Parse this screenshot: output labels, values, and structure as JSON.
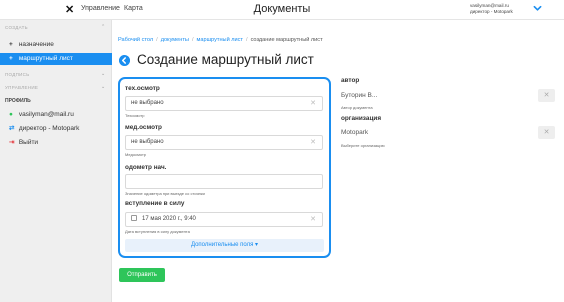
{
  "topbar": {
    "close_icon": "close-icon",
    "nav": [
      "Управление",
      "Карта"
    ],
    "title": "Документы",
    "user_email": "vasilyman@mail.ru",
    "user_role": "директор - Motopark",
    "chevron_color": "#1a8ef0"
  },
  "sidebar": {
    "section_create": "СОЗДАТЬ",
    "items_create": [
      {
        "icon": "+",
        "label": "назначение",
        "active": false
      },
      {
        "icon": "+",
        "label": "маршрутный лист",
        "active": true
      }
    ],
    "section_sign": "ПОДПИСЬ",
    "section_manage": "УПРАВЛЕНИЕ",
    "profile_title": "ПРОФИЛЬ",
    "profile_items": [
      {
        "icon": "user-icon",
        "label": "vasilyman@mail.ru",
        "color": "#2ec55a"
      },
      {
        "icon": "switch-icon",
        "label": "директор - Motopark",
        "color": "#1a8ef0"
      },
      {
        "icon": "logout-icon",
        "label": "Выйти",
        "color": "#e5484d"
      }
    ]
  },
  "breadcrumb": [
    "Рабочий стол",
    "документы",
    "маршрутный лист",
    "создание маршрутный лист"
  ],
  "page_title": "Создание маршрутный лист",
  "form": {
    "fields": [
      {
        "label": "тех.осмотр",
        "value": "не выбрано",
        "help": "Техосмотр"
      },
      {
        "label": "мед.осмотр",
        "value": "не выбрано",
        "help": "Медосмотр"
      },
      {
        "label": "одометр нач.",
        "value": "",
        "help": "Значение одометра при выезде со стоянки"
      },
      {
        "label": "вступление в силу",
        "value": "17 мая 2020 г., 9:40",
        "help": "Дата вступления в силу документа"
      }
    ],
    "extra_label": "Дополнительные поля"
  },
  "submit_label": "Отправить",
  "right": {
    "author_label": "автор",
    "author_value": "Буторин В...",
    "author_help": "Автор документа",
    "org_label": "организация",
    "org_value": "Motopark",
    "org_help": "Выберите организацию"
  },
  "colors": {
    "accent": "#1a8ef0",
    "success": "#2ec55a",
    "danger": "#e5484d"
  }
}
